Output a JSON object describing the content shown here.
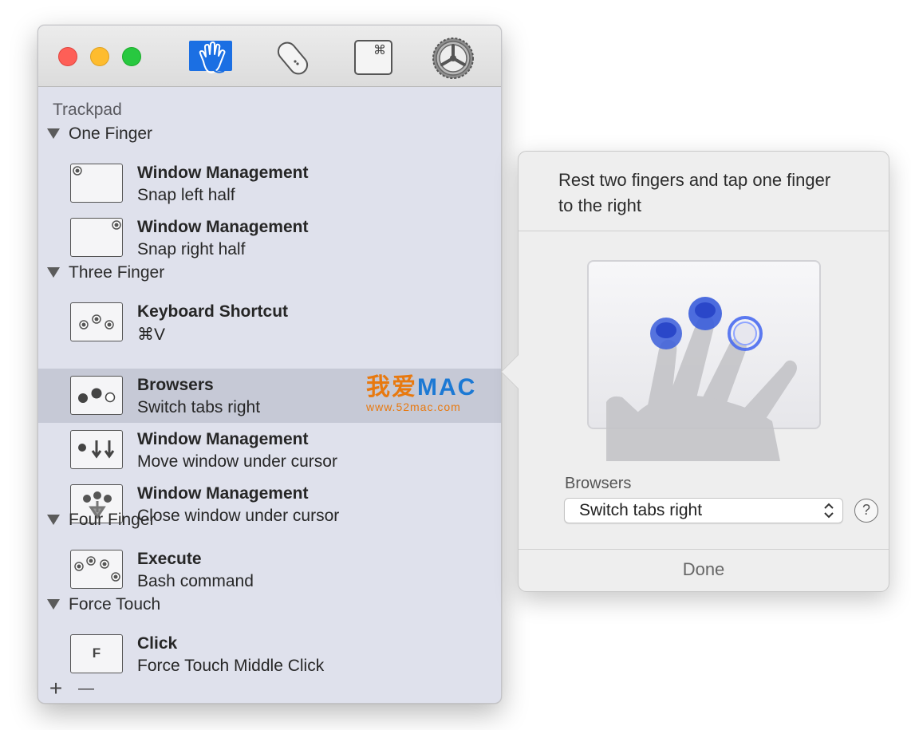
{
  "toolbar": {
    "items": [
      {
        "icon": "hand-gesture-icon",
        "selected": true
      },
      {
        "icon": "mouse-icon",
        "selected": false
      },
      {
        "icon": "command-key-icon",
        "selected": false,
        "glyph": "⌘"
      },
      {
        "icon": "gear-icon",
        "selected": false
      }
    ]
  },
  "sidebar": {
    "section_title": "Trackpad",
    "groups": [
      {
        "label": "One Finger"
      },
      {
        "label": "Three Finger"
      },
      {
        "label": "Four Finger"
      },
      {
        "label": "Force Touch"
      }
    ],
    "rows": [
      {
        "title": "Window Management",
        "subtitle": "Snap left half",
        "icon": "one-finger-top-left-icon"
      },
      {
        "title": "Window Management",
        "subtitle": "Snap right half",
        "icon": "one-finger-top-right-icon"
      },
      {
        "title": "Keyboard Shortcut",
        "subtitle": "⌘V",
        "icon": "three-finger-tap-icon"
      },
      {
        "title": "Browsers",
        "subtitle": "Switch tabs right",
        "icon": "three-finger-rest-tap-right-icon",
        "selected": true
      },
      {
        "title": "Window Management",
        "subtitle": "Move window under cursor",
        "icon": "three-finger-swipe-down-icon"
      },
      {
        "title": "Window Management",
        "subtitle": "Close window under cursor",
        "icon": "three-finger-pinch-down-icon"
      },
      {
        "title": "Execute",
        "subtitle": "Bash command",
        "icon": "four-finger-tap-icon"
      },
      {
        "title": "Click",
        "subtitle": "Force Touch Middle Click",
        "icon": "force-touch-icon",
        "thumb_text": "F"
      }
    ],
    "add_label": "+",
    "remove_label": "—"
  },
  "watermark": {
    "brand_cn": "我爱",
    "brand_mac": "MAC",
    "url": "www.52mac.com"
  },
  "popover": {
    "description": "Rest two fingers and tap one finger to the right",
    "app_label": "Browsers",
    "action_value": "Switch tabs right",
    "help_label": "?",
    "done_label": "Done"
  },
  "colors": {
    "selection": "#c6c9d6",
    "sidebar_bg": "#dfe1ec",
    "accent_blue": "#1f6fe0",
    "touch_blue": "#3d5bdc"
  }
}
